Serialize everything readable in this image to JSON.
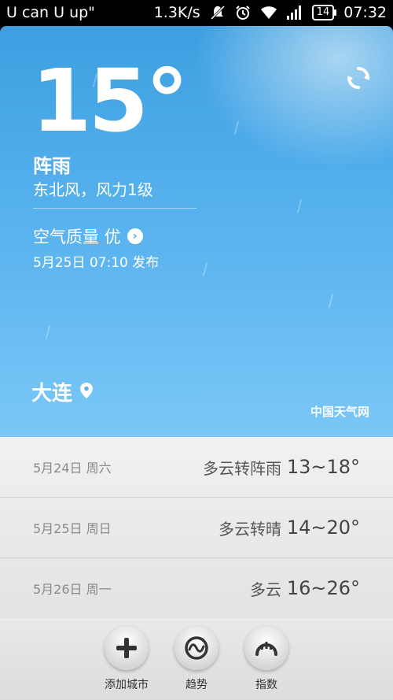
{
  "status_bar": {
    "carrier": "U can U up\"",
    "speed": "1.3K/s",
    "battery": "14",
    "time": "07:32"
  },
  "weather": {
    "temperature": "15°",
    "condition": "阵雨",
    "wind": "东北风，风力1级",
    "air_quality": "空气质量 优",
    "published": "5月25日 07:10 发布",
    "city": "大连",
    "source": "中国天气网"
  },
  "forecast": [
    {
      "date": "5月24日 周六",
      "condition": "多云转阵雨",
      "range": "13~18°"
    },
    {
      "date": "5月25日 周日",
      "condition": "多云转晴",
      "range": "14~20°"
    },
    {
      "date": "5月26日 周一",
      "condition": "多云",
      "range": "16~26°"
    }
  ],
  "bottom_bar": {
    "add_city": "添加城市",
    "trend": "趋势",
    "index": "指数"
  },
  "icons": {
    "mute": "mute-icon",
    "alarm": "alarm-icon",
    "wifi": "wifi-icon",
    "signal": "signal-icon",
    "refresh": "refresh-icon",
    "location": "location-pin-icon",
    "add": "plus-icon",
    "trend": "trend-icon",
    "index": "gauge-icon"
  },
  "colors": {
    "sky_top": "#3d9fe0",
    "sky_bottom": "#7ac7f6"
  }
}
